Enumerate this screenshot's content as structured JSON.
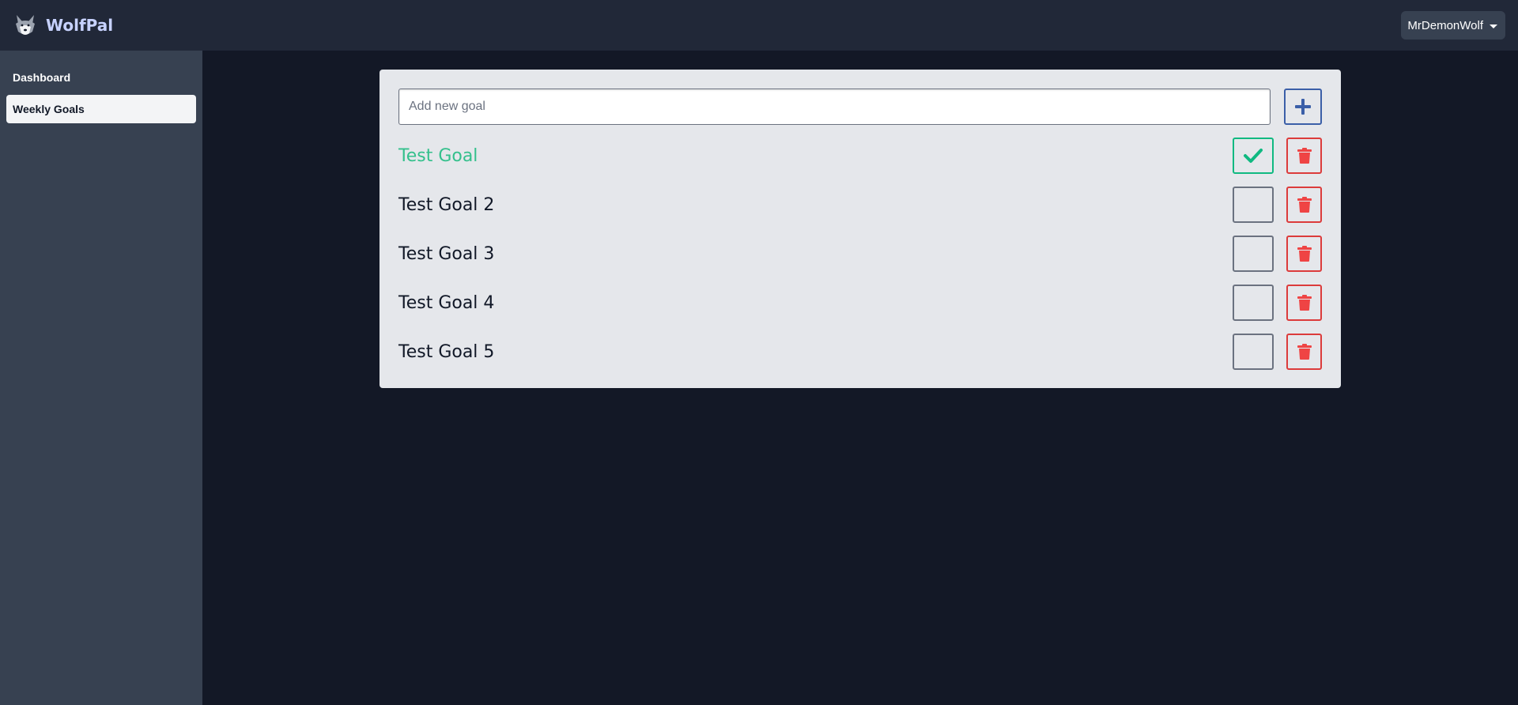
{
  "app": {
    "name": "WolfPal",
    "logo_icon": "wolf-logo-icon"
  },
  "user_menu": {
    "username": "MrDemonWolf",
    "icon": "caret-down-icon"
  },
  "sidebar": {
    "items": [
      {
        "label": "Dashboard",
        "active": false
      },
      {
        "label": "Weekly Goals",
        "active": true
      }
    ]
  },
  "add_goal": {
    "placeholder": "Add new goal",
    "value": "",
    "button_icon": "plus-icon"
  },
  "goals": [
    {
      "text": "Test Goal",
      "completed": true
    },
    {
      "text": "Test Goal 2",
      "completed": false
    },
    {
      "text": "Test Goal 3",
      "completed": false
    },
    {
      "text": "Test Goal 4",
      "completed": false
    },
    {
      "text": "Test Goal 5",
      "completed": false
    }
  ],
  "icons": {
    "complete": "checkmark-icon",
    "delete": "trash-icon"
  },
  "colors": {
    "topbar": "#212838",
    "sidebar": "#374151",
    "background": "#131826",
    "card": "#e5e7eb",
    "brand_text": "#c7d2fe",
    "completed": "#10b981",
    "delete": "#ef4444",
    "add": "#3b5fa8"
  }
}
